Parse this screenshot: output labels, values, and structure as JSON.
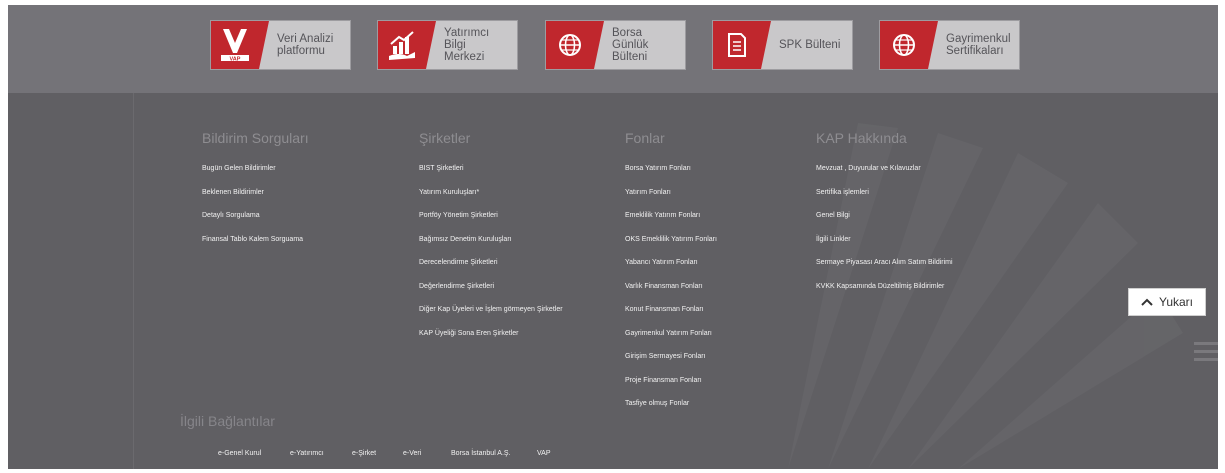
{
  "cards": [
    {
      "label": "Veri Analizi\nplatformu",
      "icon": "vap-logo-icon"
    },
    {
      "label": "Yatırımcı\nBilgi\nMerkezi",
      "icon": "investor-growth-icon"
    },
    {
      "label": "Borsa\nGünlük\nBülteni",
      "icon": "globe-icon"
    },
    {
      "label": "SPK Bülteni",
      "icon": "document-icon"
    },
    {
      "label": "Gayrimenkul\nSertifikaları",
      "icon": "globe-icon"
    }
  ],
  "vap_logo_text": "VAP",
  "columns": [
    {
      "title": "Bildirim Sorguları",
      "links": [
        "Bugün Gelen Bildirimler",
        "Beklenen Bildirimler",
        "Detaylı Sorgulama",
        "Finansal Tablo Kalem Sorguama"
      ]
    },
    {
      "title": "Şirketler",
      "links": [
        "BIST Şirketleri",
        "Yatırım Kuruluşları*",
        "Portföy Yönetim Şirketleri",
        "Bağımsız Denetim Kuruluşları",
        "Derecelendirme Şirketleri",
        "Değerlendirme Şirketleri",
        "Diğer Kap Üyeleri ve İşlem görmeyen Şirketler",
        "KAP Üyeliği Sona Eren Şirketler"
      ]
    },
    {
      "title": "Fonlar",
      "links": [
        "Borsa Yatırım Fonları",
        "Yatırım Fonları",
        "Emeklilik Yatırım Fonları",
        "OKS Emeklilik Yatırım Fonları",
        "Yabancı Yatırım Fonları",
        "Varlık Finansman Fonları",
        "Konut Finansman Fonları",
        "Gayrimenkul Yatırım Fonları",
        "Girişim Sermayesi Fonları",
        "Proje Finansman Fonları",
        "Tasfiye olmuş Fonlar"
      ]
    },
    {
      "title": "KAP Hakkında",
      "links": [
        "Mevzuat , Duyurular ve Kılavuzlar",
        "Sertifika işlemleri",
        "Genel Bilgi",
        "İlgili Linkler",
        "Sermaye Piyasası Aracı Alım Satım Bildirimi",
        "KVKK Kapsamında Düzeltilmiş Bildirimler"
      ]
    }
  ],
  "related": {
    "title": "İlgili Bağlantılar",
    "links": [
      "e-Genel Kurul",
      "e-Yatırımcı",
      "e-Şirket",
      "e-Veri",
      "Borsa İstanbul A.Ş.",
      "VAP"
    ]
  },
  "scroll_top": {
    "label": "Yukarı",
    "icon": "chevron-up-icon"
  },
  "menu": {
    "icon": "hamburger-menu-icon"
  },
  "colors": {
    "brand_red": "#c0272d",
    "footer_bg": "#605f63",
    "topbar_bg": "#747378"
  }
}
